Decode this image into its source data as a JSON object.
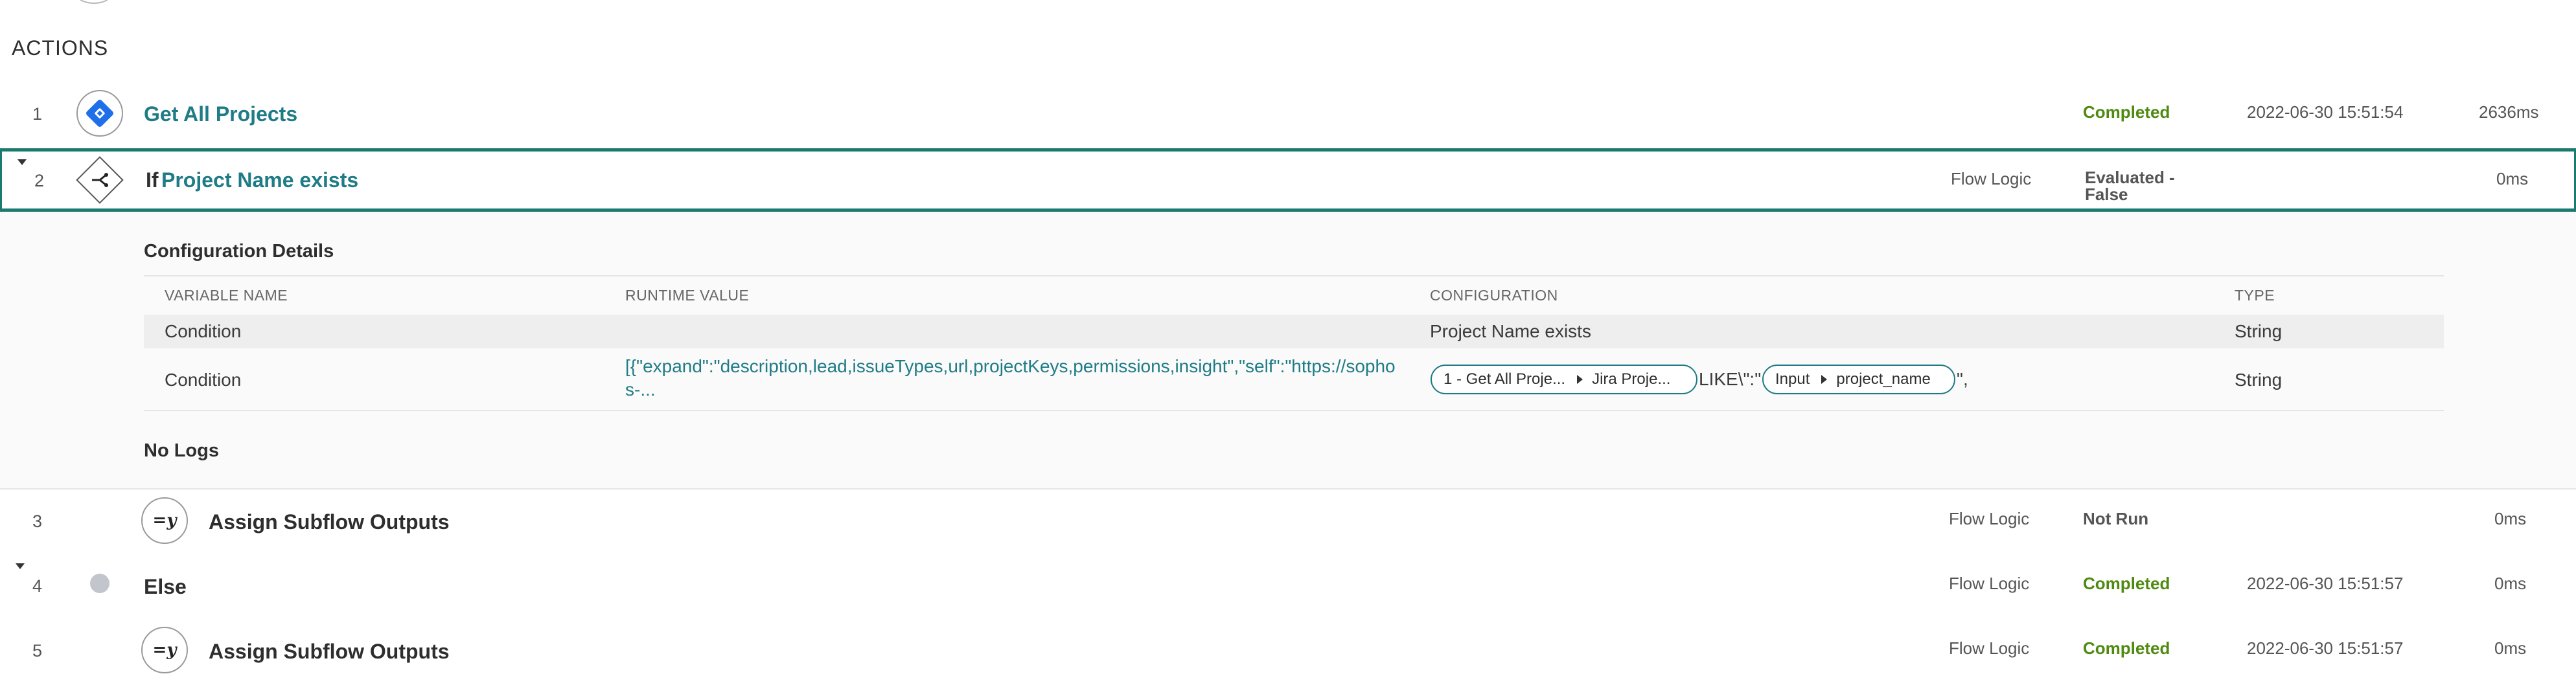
{
  "section": {
    "title": "ACTIONS"
  },
  "rows": [
    {
      "num": "1",
      "title": "Get All Projects",
      "flow": "",
      "status": "Completed",
      "timestamp": "2022-06-30 15:51:54",
      "duration": "2636ms",
      "icon": "jira-icon"
    },
    {
      "num": "2",
      "prefix": "If",
      "title": "Project Name exists",
      "flow": "Flow Logic",
      "status": "Evaluated -",
      "status2": "False",
      "timestamp": "",
      "duration": "0ms",
      "icon": "if-branch-icon"
    },
    {
      "num": "3",
      "title": "Assign Subflow Outputs",
      "flow": "Flow Logic",
      "status": "Not Run",
      "timestamp": "",
      "duration": "0ms",
      "icon": "assign-icon"
    },
    {
      "num": "4",
      "title": "Else",
      "flow": "Flow Logic",
      "status": "Completed",
      "timestamp": "2022-06-30 15:51:57",
      "duration": "0ms",
      "icon": "else-dot-icon"
    },
    {
      "num": "5",
      "title": "Assign Subflow Outputs",
      "flow": "Flow Logic",
      "status": "Completed",
      "timestamp": "2022-06-30 15:51:57",
      "duration": "0ms",
      "icon": "assign-icon"
    }
  ],
  "details": {
    "title": "Configuration Details",
    "headers": [
      "VARIABLE NAME",
      "RUNTIME VALUE",
      "CONFIGURATION",
      "TYPE"
    ],
    "rows": [
      {
        "name": "Condition",
        "runtime": "",
        "config": "Project Name exists",
        "type": "String"
      },
      {
        "name": "Condition",
        "runtime": "[{\"expand\":\"description,lead,issueTypes,url,projectKeys,permissions,insight\",\"self\":\"https://sophos-...",
        "pill1_a": "1 - Get All Proje...",
        "pill1_b": "Jira Proje...",
        "like_text": "LIKE\\\":\"",
        "pill2_a": "Input",
        "pill2_b": "project_name",
        "tail_text": "\",",
        "type": "String"
      }
    ],
    "no_logs": "No Logs"
  },
  "assign_icon_text": "=y",
  "colors": {
    "accent": "#1a7a6f",
    "link": "#1f7c86",
    "completed": "#4f8a10"
  }
}
